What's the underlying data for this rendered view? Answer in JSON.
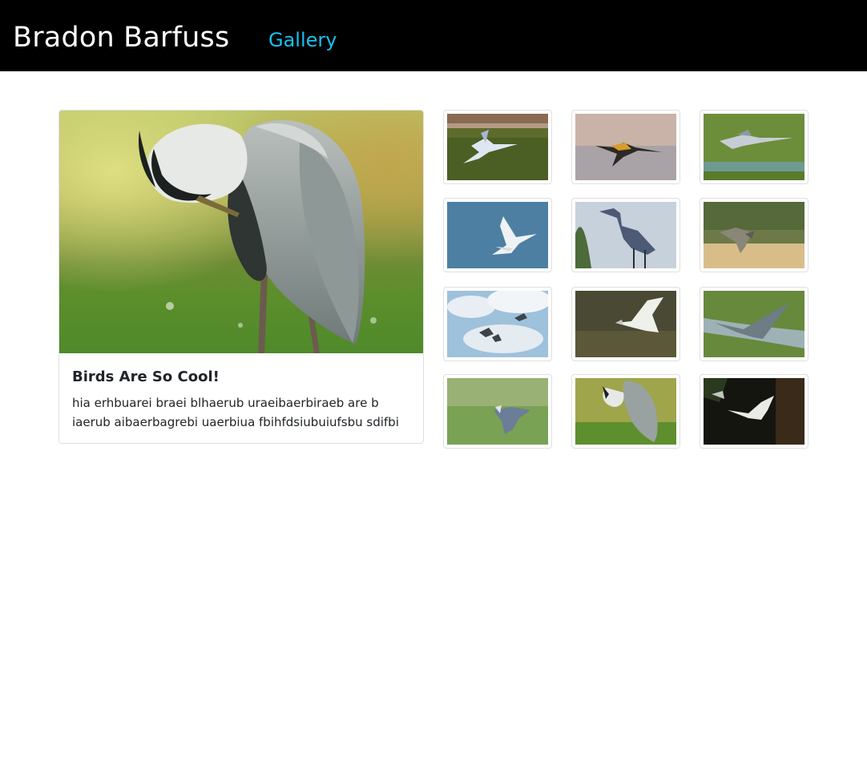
{
  "navbar": {
    "brand": "Bradon Barfuss",
    "gallery_link": "Gallery",
    "link_color": "#17c1f0"
  },
  "featured": {
    "title": "Birds Are So Cool!",
    "text": "hia erhbuarei braei blhaerub uraeibaerbiraeb are b iaerub aibaerbagrebi uaerbiua fbihfdsiubuiufsbu sdifbi",
    "image_icon": "heron-preening-photo"
  },
  "gallery": {
    "thumbnails": [
      {
        "name": "heron-flying-over-water-photo"
      },
      {
        "name": "heron-sunset-flight-photo"
      },
      {
        "name": "heron-flying-over-green-water-photo"
      },
      {
        "name": "egret-blue-sky-photo"
      },
      {
        "name": "great-blue-heron-standing-photo"
      },
      {
        "name": "heron-over-reeds-photo"
      },
      {
        "name": "birds-in-clouds-photo"
      },
      {
        "name": "egret-dark-field-photo"
      },
      {
        "name": "heron-landing-stream-photo"
      },
      {
        "name": "heron-low-flight-grass-photo"
      },
      {
        "name": "heron-preening-thumb-photo"
      },
      {
        "name": "egret-dark-water-photo"
      }
    ]
  }
}
